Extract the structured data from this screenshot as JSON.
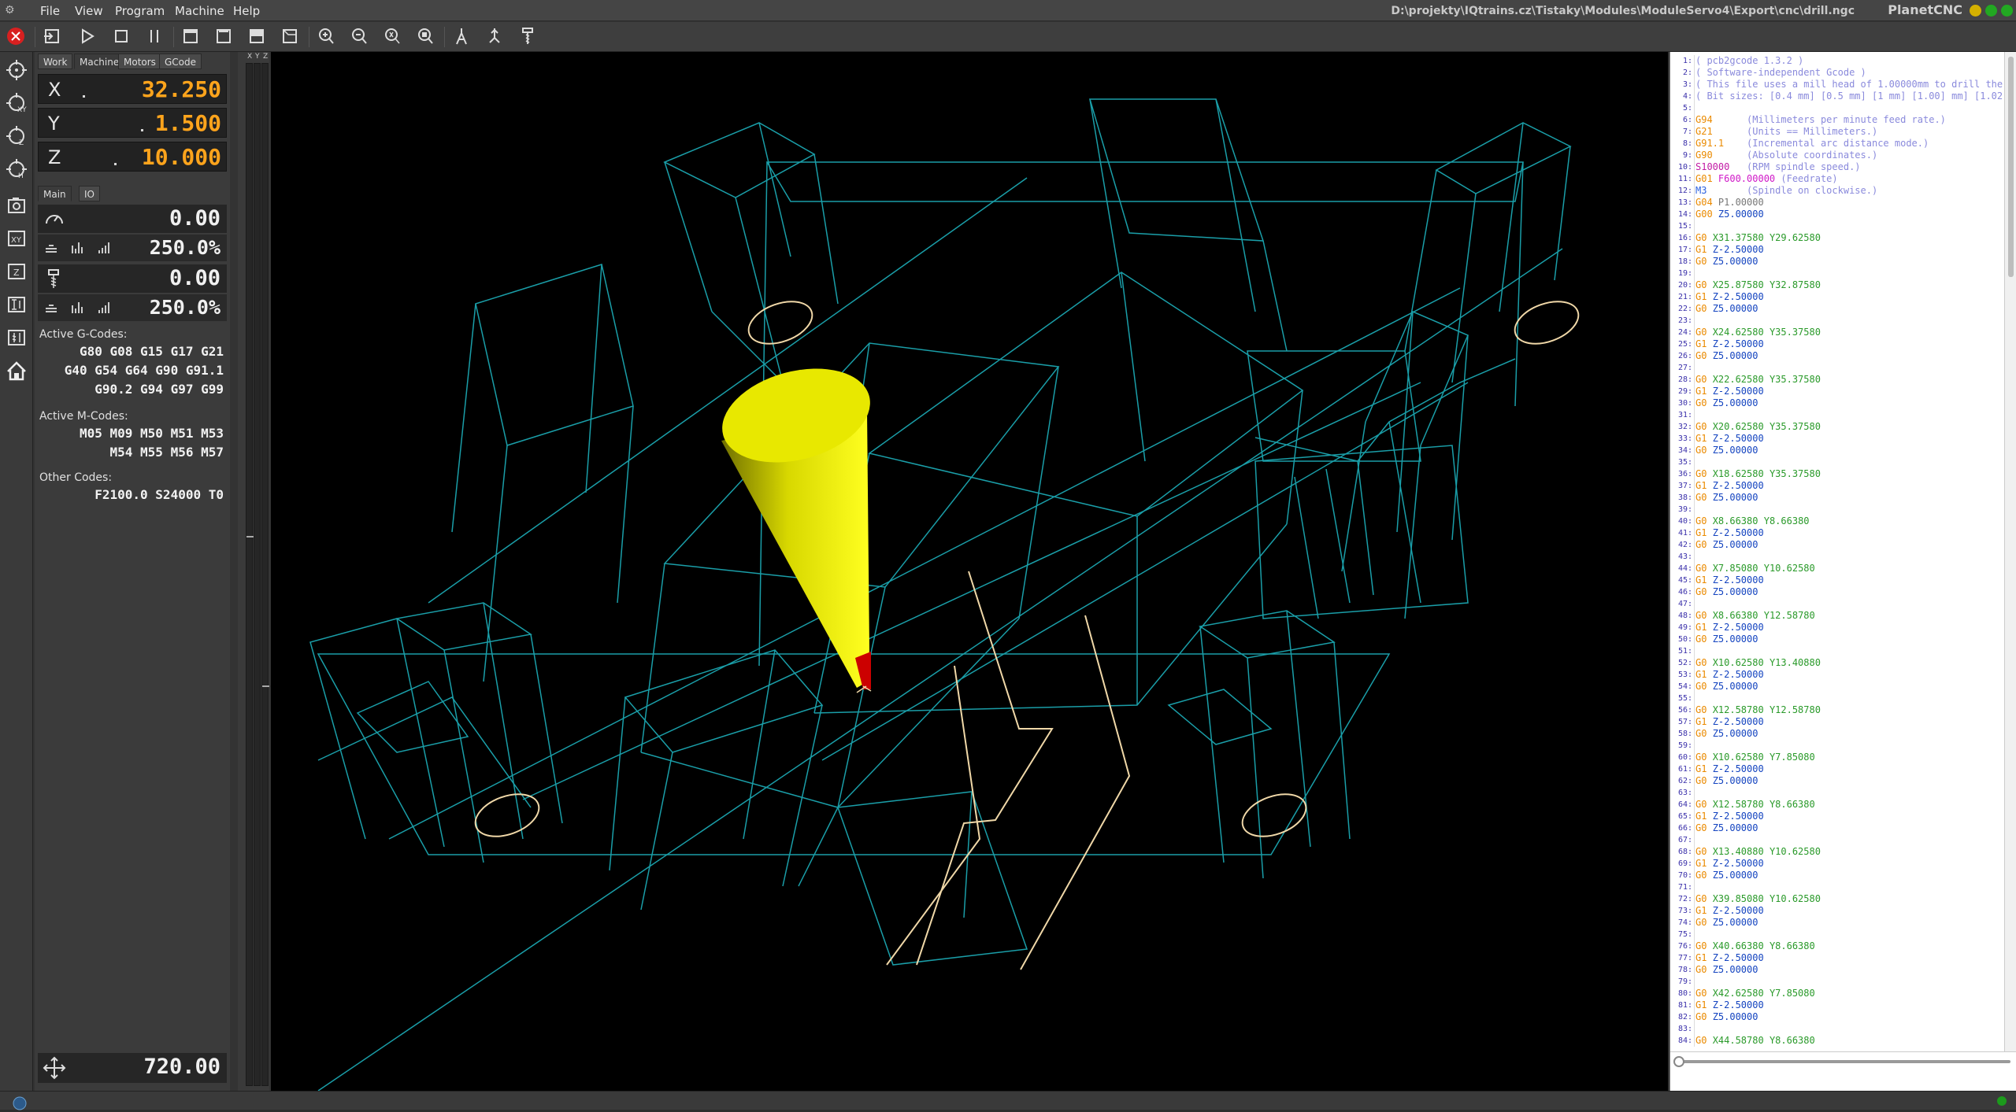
{
  "window": {
    "file_path": "D:\\projekty\\IQtrains.cz\\Tistaky\\Modules\\ModuleServo4\\Export\\cnc\\drill.ngc",
    "app_name": "PlanetCNC"
  },
  "menu": [
    "File",
    "View",
    "Program",
    "Machine",
    "Help"
  ],
  "toolbar": {
    "icons": [
      "estop-icon",
      "open-file-icon",
      "play-icon",
      "stop-icon",
      "pause-icon",
      "view-front-icon",
      "view-side-icon",
      "view-top-icon",
      "view-iso-icon",
      "zoom-in-icon",
      "zoom-out-icon",
      "zoom-fit-icon",
      "zoom-window-icon",
      "toolpath-icon",
      "probe-icon",
      "tool-icon"
    ]
  },
  "left_strip": {
    "icons": [
      "goto-zero-xyz-icon",
      "goto-zero-xy-icon",
      "goto-zero-z-icon",
      "goto-home-icon",
      "camera-icon",
      "set-xy-icon",
      "set-z-icon",
      "measure-icon",
      "tool-length-icon",
      "home-icon"
    ]
  },
  "panel": {
    "tabs": [
      "Work",
      "Machine",
      "Motors",
      "GCode"
    ],
    "active_tab": "Machine",
    "coords": {
      "x": {
        "label": "X",
        "value": "32.250"
      },
      "y": {
        "label": "Y",
        "value": "1.500"
      },
      "z": {
        "label": "Z",
        "value": "10.000"
      }
    },
    "subtabs": [
      "Main",
      "IO"
    ],
    "active_subtab": "Main",
    "feed": {
      "value": "0.00",
      "override": "250.0%"
    },
    "spindle": {
      "value": "0.00",
      "override": "250.0%"
    },
    "active_gcodes_label": "Active G-Codes:",
    "active_gcodes": [
      "G80 G08 G15 G17 G21",
      "G40 G54 G64 G90 G91.1",
      "G90.2 G94 G97 G99"
    ],
    "active_mcodes_label": "Active M-Codes:",
    "active_mcodes": [
      "M05 M09 M50 M51 M53",
      "M54 M55 M56 M57"
    ],
    "other_codes_label": "Other Codes:",
    "other_codes": [
      "F2100.0 S24000 T0"
    ],
    "jog_speed": "720.00"
  },
  "vertical_axis_labels": [
    "X",
    "Y",
    "Z"
  ],
  "colors": {
    "accent_orange": "#ffa41c",
    "toolpath_cyan": "#1aa0a8",
    "drill_path": "#f0d8a8",
    "tool_yellow": "#e6e600",
    "tool_tip_red": "#cc0000",
    "estop_red": "#d82020"
  },
  "gcode": [
    {
      "n": "1",
      "t": [
        [
          "com",
          "( pcb2gcode 1.3.2 )"
        ]
      ]
    },
    {
      "n": "2",
      "t": [
        [
          "com",
          "( Software-independent Gcode )"
        ]
      ]
    },
    {
      "n": "3",
      "t": [
        [
          "com",
          "( This file uses a mill head of 1.00000mm to drill the"
        ]
      ]
    },
    {
      "n": "4",
      "t": [
        [
          "com",
          "( Bit sizes: [0.4 mm] [0.5 mm] [1 mm] [1.00] mm] [1.02"
        ]
      ]
    },
    {
      "n": "5",
      "t": []
    },
    {
      "n": "6",
      "t": [
        [
          "g",
          "G94"
        ],
        [
          "com",
          "      (Millimeters per minute feed rate.)"
        ]
      ]
    },
    {
      "n": "7",
      "t": [
        [
          "g",
          "G21"
        ],
        [
          "com",
          "      (Units == Millimeters.)"
        ]
      ]
    },
    {
      "n": "8",
      "t": [
        [
          "g",
          "G91.1"
        ],
        [
          "com",
          "    (Incremental arc distance mode.)"
        ]
      ]
    },
    {
      "n": "9",
      "t": [
        [
          "g",
          "G90"
        ],
        [
          "com",
          "      (Absolute coordinates.)"
        ]
      ]
    },
    {
      "n": "10",
      "t": [
        [
          "s",
          "S10000"
        ],
        [
          "com",
          "   (RPM spindle speed.)"
        ]
      ]
    },
    {
      "n": "11",
      "t": [
        [
          "g",
          "G01 "
        ],
        [
          "f",
          "F600.00000"
        ],
        [
          "com",
          " (Feedrate)"
        ]
      ]
    },
    {
      "n": "12",
      "t": [
        [
          "m",
          "M3"
        ],
        [
          "com",
          "       (Spindle on clockwise.)"
        ]
      ]
    },
    {
      "n": "13",
      "t": [
        [
          "g",
          "G04 "
        ],
        [
          "p",
          "P1.00000"
        ]
      ]
    },
    {
      "n": "14",
      "t": [
        [
          "g",
          "G00 "
        ],
        [
          "z",
          "Z5.00000"
        ]
      ]
    },
    {
      "n": "15",
      "t": []
    },
    {
      "n": "16",
      "t": [
        [
          "g",
          "G0 "
        ],
        [
          "x",
          "X31.37580 "
        ],
        [
          "y",
          "Y29.62580"
        ]
      ]
    },
    {
      "n": "17",
      "t": [
        [
          "g",
          "G1 "
        ],
        [
          "z",
          "Z-2.50000"
        ]
      ]
    },
    {
      "n": "18",
      "t": [
        [
          "g",
          "G0 "
        ],
        [
          "z",
          "Z5.00000"
        ]
      ]
    },
    {
      "n": "19",
      "t": []
    },
    {
      "n": "20",
      "t": [
        [
          "g",
          "G0 "
        ],
        [
          "x",
          "X25.87580 "
        ],
        [
          "y",
          "Y32.87580"
        ]
      ]
    },
    {
      "n": "21",
      "t": [
        [
          "g",
          "G1 "
        ],
        [
          "z",
          "Z-2.50000"
        ]
      ]
    },
    {
      "n": "22",
      "t": [
        [
          "g",
          "G0 "
        ],
        [
          "z",
          "Z5.00000"
        ]
      ]
    },
    {
      "n": "23",
      "t": []
    },
    {
      "n": "24",
      "t": [
        [
          "g",
          "G0 "
        ],
        [
          "x",
          "X24.62580 "
        ],
        [
          "y",
          "Y35.37580"
        ]
      ]
    },
    {
      "n": "25",
      "t": [
        [
          "g",
          "G1 "
        ],
        [
          "z",
          "Z-2.50000"
        ]
      ]
    },
    {
      "n": "26",
      "t": [
        [
          "g",
          "G0 "
        ],
        [
          "z",
          "Z5.00000"
        ]
      ]
    },
    {
      "n": "27",
      "t": []
    },
    {
      "n": "28",
      "t": [
        [
          "g",
          "G0 "
        ],
        [
          "x",
          "X22.62580 "
        ],
        [
          "y",
          "Y35.37580"
        ]
      ]
    },
    {
      "n": "29",
      "t": [
        [
          "g",
          "G1 "
        ],
        [
          "z",
          "Z-2.50000"
        ]
      ]
    },
    {
      "n": "30",
      "t": [
        [
          "g",
          "G0 "
        ],
        [
          "z",
          "Z5.00000"
        ]
      ]
    },
    {
      "n": "31",
      "t": []
    },
    {
      "n": "32",
      "t": [
        [
          "g",
          "G0 "
        ],
        [
          "x",
          "X20.62580 "
        ],
        [
          "y",
          "Y35.37580"
        ]
      ]
    },
    {
      "n": "33",
      "t": [
        [
          "g",
          "G1 "
        ],
        [
          "z",
          "Z-2.50000"
        ]
      ]
    },
    {
      "n": "34",
      "t": [
        [
          "g",
          "G0 "
        ],
        [
          "z",
          "Z5.00000"
        ]
      ]
    },
    {
      "n": "35",
      "t": []
    },
    {
      "n": "36",
      "t": [
        [
          "g",
          "G0 "
        ],
        [
          "x",
          "X18.62580 "
        ],
        [
          "y",
          "Y35.37580"
        ]
      ]
    },
    {
      "n": "37",
      "t": [
        [
          "g",
          "G1 "
        ],
        [
          "z",
          "Z-2.50000"
        ]
      ]
    },
    {
      "n": "38",
      "t": [
        [
          "g",
          "G0 "
        ],
        [
          "z",
          "Z5.00000"
        ]
      ]
    },
    {
      "n": "39",
      "t": []
    },
    {
      "n": "40",
      "t": [
        [
          "g",
          "G0 "
        ],
        [
          "x",
          "X8.66380 "
        ],
        [
          "y",
          "Y8.66380"
        ]
      ]
    },
    {
      "n": "41",
      "t": [
        [
          "g",
          "G1 "
        ],
        [
          "z",
          "Z-2.50000"
        ]
      ]
    },
    {
      "n": "42",
      "t": [
        [
          "g",
          "G0 "
        ],
        [
          "z",
          "Z5.00000"
        ]
      ]
    },
    {
      "n": "43",
      "t": []
    },
    {
      "n": "44",
      "t": [
        [
          "g",
          "G0 "
        ],
        [
          "x",
          "X7.85080 "
        ],
        [
          "y",
          "Y10.62580"
        ]
      ]
    },
    {
      "n": "45",
      "t": [
        [
          "g",
          "G1 "
        ],
        [
          "z",
          "Z-2.50000"
        ]
      ]
    },
    {
      "n": "46",
      "t": [
        [
          "g",
          "G0 "
        ],
        [
          "z",
          "Z5.00000"
        ]
      ]
    },
    {
      "n": "47",
      "t": []
    },
    {
      "n": "48",
      "t": [
        [
          "g",
          "G0 "
        ],
        [
          "x",
          "X8.66380 "
        ],
        [
          "y",
          "Y12.58780"
        ]
      ]
    },
    {
      "n": "49",
      "t": [
        [
          "g",
          "G1 "
        ],
        [
          "z",
          "Z-2.50000"
        ]
      ]
    },
    {
      "n": "50",
      "t": [
        [
          "g",
          "G0 "
        ],
        [
          "z",
          "Z5.00000"
        ]
      ]
    },
    {
      "n": "51",
      "t": []
    },
    {
      "n": "52",
      "t": [
        [
          "g",
          "G0 "
        ],
        [
          "x",
          "X10.62580 "
        ],
        [
          "y",
          "Y13.40880"
        ]
      ]
    },
    {
      "n": "53",
      "t": [
        [
          "g",
          "G1 "
        ],
        [
          "z",
          "Z-2.50000"
        ]
      ]
    },
    {
      "n": "54",
      "t": [
        [
          "g",
          "G0 "
        ],
        [
          "z",
          "Z5.00000"
        ]
      ]
    },
    {
      "n": "55",
      "t": []
    },
    {
      "n": "56",
      "t": [
        [
          "g",
          "G0 "
        ],
        [
          "x",
          "X12.58780 "
        ],
        [
          "y",
          "Y12.58780"
        ]
      ]
    },
    {
      "n": "57",
      "t": [
        [
          "g",
          "G1 "
        ],
        [
          "z",
          "Z-2.50000"
        ]
      ]
    },
    {
      "n": "58",
      "t": [
        [
          "g",
          "G0 "
        ],
        [
          "z",
          "Z5.00000"
        ]
      ]
    },
    {
      "n": "59",
      "t": []
    },
    {
      "n": "60",
      "t": [
        [
          "g",
          "G0 "
        ],
        [
          "x",
          "X10.62580 "
        ],
        [
          "y",
          "Y7.85080"
        ]
      ]
    },
    {
      "n": "61",
      "t": [
        [
          "g",
          "G1 "
        ],
        [
          "z",
          "Z-2.50000"
        ]
      ]
    },
    {
      "n": "62",
      "t": [
        [
          "g",
          "G0 "
        ],
        [
          "z",
          "Z5.00000"
        ]
      ]
    },
    {
      "n": "63",
      "t": []
    },
    {
      "n": "64",
      "t": [
        [
          "g",
          "G0 "
        ],
        [
          "x",
          "X12.58780 "
        ],
        [
          "y",
          "Y8.66380"
        ]
      ]
    },
    {
      "n": "65",
      "t": [
        [
          "g",
          "G1 "
        ],
        [
          "z",
          "Z-2.50000"
        ]
      ]
    },
    {
      "n": "66",
      "t": [
        [
          "g",
          "G0 "
        ],
        [
          "z",
          "Z5.00000"
        ]
      ]
    },
    {
      "n": "67",
      "t": []
    },
    {
      "n": "68",
      "t": [
        [
          "g",
          "G0 "
        ],
        [
          "x",
          "X13.40880 "
        ],
        [
          "y",
          "Y10.62580"
        ]
      ]
    },
    {
      "n": "69",
      "t": [
        [
          "g",
          "G1 "
        ],
        [
          "z",
          "Z-2.50000"
        ]
      ]
    },
    {
      "n": "70",
      "t": [
        [
          "g",
          "G0 "
        ],
        [
          "z",
          "Z5.00000"
        ]
      ]
    },
    {
      "n": "71",
      "t": []
    },
    {
      "n": "72",
      "t": [
        [
          "g",
          "G0 "
        ],
        [
          "x",
          "X39.85080 "
        ],
        [
          "y",
          "Y10.62580"
        ]
      ]
    },
    {
      "n": "73",
      "t": [
        [
          "g",
          "G1 "
        ],
        [
          "z",
          "Z-2.50000"
        ]
      ]
    },
    {
      "n": "74",
      "t": [
        [
          "g",
          "G0 "
        ],
        [
          "z",
          "Z5.00000"
        ]
      ]
    },
    {
      "n": "75",
      "t": []
    },
    {
      "n": "76",
      "t": [
        [
          "g",
          "G0 "
        ],
        [
          "x",
          "X40.66380 "
        ],
        [
          "y",
          "Y8.66380"
        ]
      ]
    },
    {
      "n": "77",
      "t": [
        [
          "g",
          "G1 "
        ],
        [
          "z",
          "Z-2.50000"
        ]
      ]
    },
    {
      "n": "78",
      "t": [
        [
          "g",
          "G0 "
        ],
        [
          "z",
          "Z5.00000"
        ]
      ]
    },
    {
      "n": "79",
      "t": []
    },
    {
      "n": "80",
      "t": [
        [
          "g",
          "G0 "
        ],
        [
          "x",
          "X42.62580 "
        ],
        [
          "y",
          "Y7.85080"
        ]
      ]
    },
    {
      "n": "81",
      "t": [
        [
          "g",
          "G1 "
        ],
        [
          "z",
          "Z-2.50000"
        ]
      ]
    },
    {
      "n": "82",
      "t": [
        [
          "g",
          "G0 "
        ],
        [
          "z",
          "Z5.00000"
        ]
      ]
    },
    {
      "n": "83",
      "t": []
    },
    {
      "n": "84",
      "t": [
        [
          "g",
          "G0 "
        ],
        [
          "x",
          "X44.58780 "
        ],
        [
          "y",
          "Y8.66380"
        ]
      ]
    }
  ]
}
